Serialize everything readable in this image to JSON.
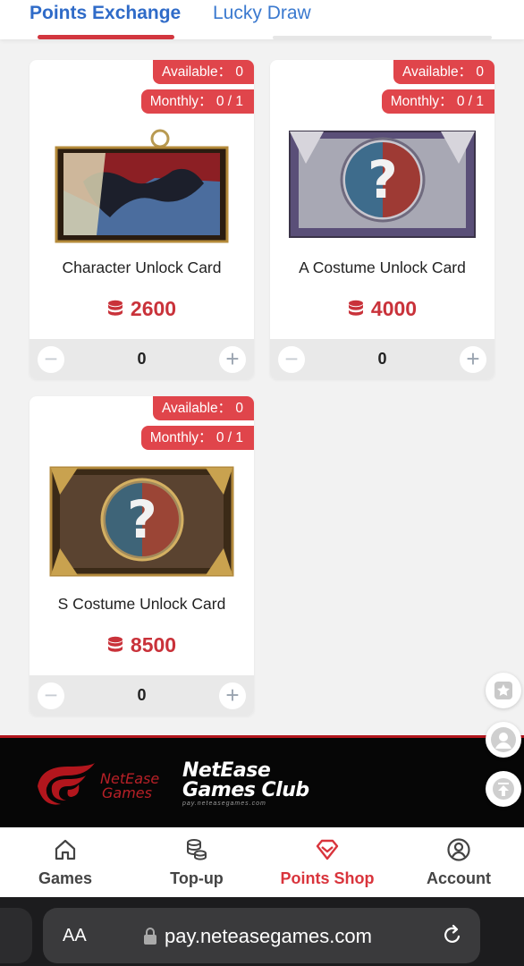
{
  "tabs": [
    {
      "label": "Points Exchange",
      "active": true
    },
    {
      "label": "Lucky Draw",
      "active": false
    }
  ],
  "cards": [
    {
      "available": "Available： 0",
      "monthly": "Monthly： 0 / 1",
      "title": "Character Unlock Card",
      "price": "2600",
      "quantity": "0",
      "image": "character-unlock-card-image"
    },
    {
      "available": "Available： 0",
      "monthly": "Monthly： 0 / 1",
      "title": "A Costume Unlock Card",
      "price": "4000",
      "quantity": "0",
      "image": "a-costume-unlock-card-image"
    },
    {
      "available": "Available： 0",
      "monthly": "Monthly： 0 / 1",
      "title": "S Costume Unlock Card",
      "price": "8500",
      "quantity": "0",
      "image": "s-costume-unlock-card-image"
    }
  ],
  "stepper": {
    "minus": "−",
    "plus": "+"
  },
  "side_buttons": [
    "favorite-star-icon",
    "user-avatar-icon",
    "back-to-top-icon"
  ],
  "footer": {
    "netease_logo_line1": "NetEase",
    "netease_logo_line2": "Games",
    "club_line1": "NetEase",
    "club_line2": "Games Club",
    "club_url": "pay.neteasegames.com"
  },
  "bottom_nav": [
    {
      "label": "Games",
      "icon": "home-icon",
      "active": false
    },
    {
      "label": "Top-up",
      "icon": "coins-icon",
      "active": false
    },
    {
      "label": "Points Shop",
      "icon": "gem-icon",
      "active": true
    },
    {
      "label": "Account",
      "icon": "account-icon",
      "active": false
    }
  ],
  "browser": {
    "text_size": "AA",
    "url": "pay.neteasegames.com"
  },
  "colors": {
    "accent_red": "#d9343c",
    "tab_blue": "#2f6bc8",
    "badge_red": "#e0454b"
  }
}
